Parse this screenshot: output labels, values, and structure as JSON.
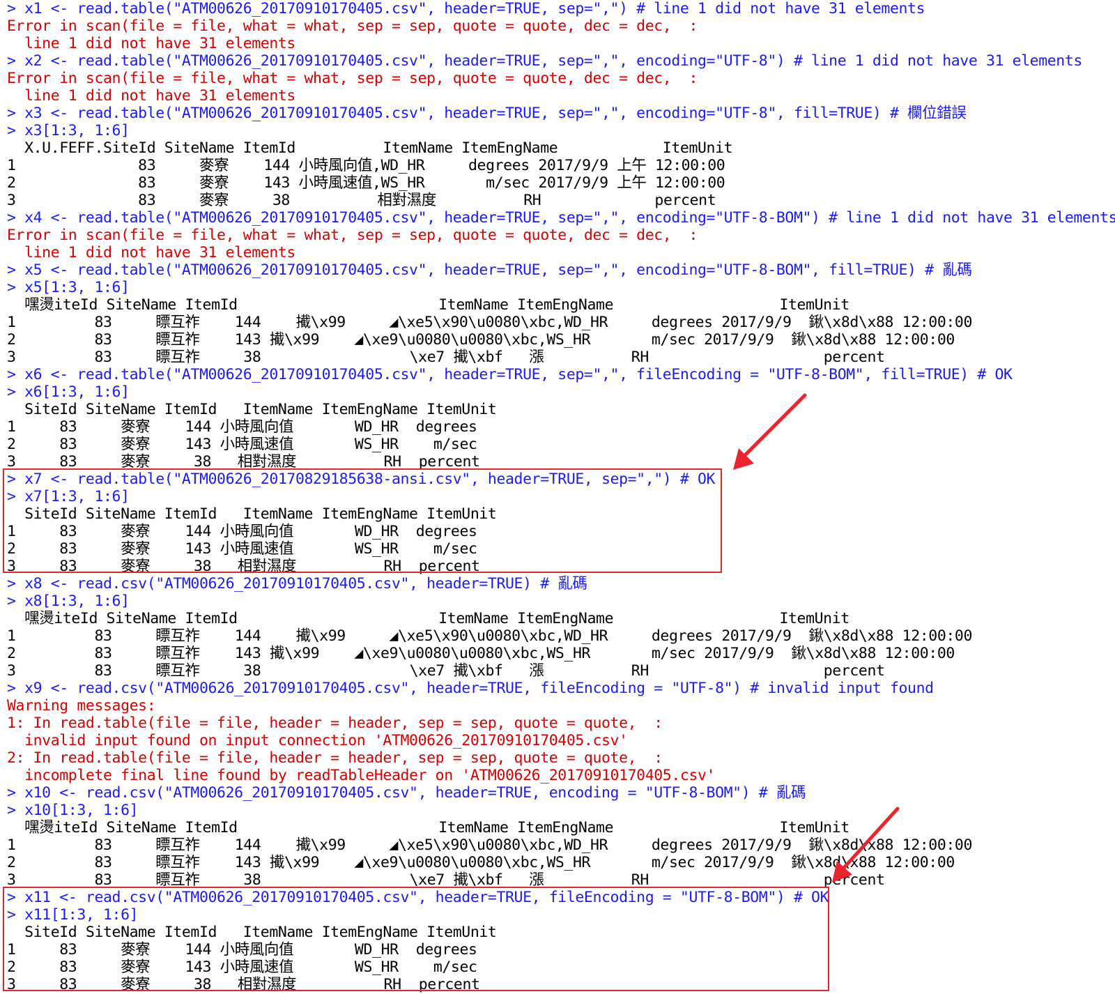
{
  "console": {
    "lines": [
      {
        "kind": "cmd",
        "text": "> x1 <- read.table(\"ATM00626_20170910170405.csv\", header=TRUE, sep=\",\") # line 1 did not have 31 elements"
      },
      {
        "kind": "err",
        "text": "Error in scan(file = file, what = what, sep = sep, quote = quote, dec = dec,  :"
      },
      {
        "kind": "err",
        "text": "  line 1 did not have 31 elements"
      },
      {
        "kind": "cmd",
        "text": "> x2 <- read.table(\"ATM00626_20170910170405.csv\", header=TRUE, sep=\",\", encoding=\"UTF-8\") # line 1 did not have 31 elements"
      },
      {
        "kind": "err",
        "text": "Error in scan(file = file, what = what, sep = sep, quote = quote, dec = dec,  :"
      },
      {
        "kind": "err",
        "text": "  line 1 did not have 31 elements"
      },
      {
        "kind": "cmd",
        "text": "> x3 <- read.table(\"ATM00626_20170910170405.csv\", header=TRUE, sep=\",\", encoding=\"UTF-8\", fill=TRUE) # 欄位錯誤"
      },
      {
        "kind": "cmd",
        "text": "> x3[1:3, 1:6]"
      },
      {
        "kind": "out",
        "text": "  X.U.FEFF.SiteId SiteName ItemId          ItemName ItemEngName            ItemUnit"
      },
      {
        "kind": "out",
        "text": "1              83     麥寮    144 小時風向值,WD_HR     degrees 2017/9/9 上午 12:00:00"
      },
      {
        "kind": "out",
        "text": "2              83     麥寮    143 小時風速值,WS_HR       m/sec 2017/9/9 上午 12:00:00"
      },
      {
        "kind": "out",
        "text": "3              83     麥寮     38          相對濕度          RH             percent"
      },
      {
        "kind": "cmd",
        "text": "> x4 <- read.table(\"ATM00626_20170910170405.csv\", header=TRUE, sep=\",\", encoding=\"UTF-8-BOM\") # line 1 did not have 31 elements"
      },
      {
        "kind": "err",
        "text": "Error in scan(file = file, what = what, sep = sep, quote = quote, dec = dec,  :"
      },
      {
        "kind": "err",
        "text": "  line 1 did not have 31 elements"
      },
      {
        "kind": "cmd",
        "text": "> x5 <- read.table(\"ATM00626_20170910170405.csv\", header=TRUE, sep=\",\", encoding=\"UTF-8-BOM\", fill=TRUE) # 亂碼"
      },
      {
        "kind": "cmd",
        "text": "> x5[1:3, 1:6]"
      },
      {
        "kind": "out",
        "text": "  嘿燙iteId SiteName ItemId                       ItemName ItemEngName                   ItemUnit"
      },
      {
        "kind": "out",
        "text": "1         83     瞟互祚    144    擮\\x99     ◢\\xe5\\x90\\u0080\\xbc,WD_HR     degrees 2017/9/9  鍬\\x8d\\x88 12:00:00"
      },
      {
        "kind": "out",
        "text": "2         83     瞟互祚    143 擮\\x99    ◢\\xe9\\u0080\\u0080\\xbc,WS_HR       m/sec 2017/9/9  鍬\\x8d\\x88 12:00:00"
      },
      {
        "kind": "out",
        "text": "3         83     瞟互祚     38                 \\xe7 擮\\xbf   漲          RH                    percent"
      },
      {
        "kind": "cmd",
        "text": "> x6 <- read.table(\"ATM00626_20170910170405.csv\", header=TRUE, sep=\",\", fileEncoding = \"UTF-8-BOM\", fill=TRUE) # OK"
      },
      {
        "kind": "cmd",
        "text": "> x6[1:3, 1:6]"
      },
      {
        "kind": "out",
        "text": "  SiteId SiteName ItemId   ItemName ItemEngName ItemUnit"
      },
      {
        "kind": "out",
        "text": "1     83     麥寮    144 小時風向值       WD_HR  degrees"
      },
      {
        "kind": "out",
        "text": "2     83     麥寮    143 小時風速值       WS_HR    m/sec"
      },
      {
        "kind": "out",
        "text": "3     83     麥寮     38   相對濕度          RH  percent"
      },
      {
        "kind": "cmd",
        "text": "> x7 <- read.table(\"ATM00626_20170829185638-ansi.csv\", header=TRUE, sep=\",\") # OK"
      },
      {
        "kind": "cmd",
        "text": "> x7[1:3, 1:6]"
      },
      {
        "kind": "out",
        "text": "  SiteId SiteName ItemId   ItemName ItemEngName ItemUnit"
      },
      {
        "kind": "out",
        "text": "1     83     麥寮    144 小時風向值       WD_HR  degrees"
      },
      {
        "kind": "out",
        "text": "2     83     麥寮    143 小時風速值       WS_HR    m/sec"
      },
      {
        "kind": "out",
        "text": "3     83     麥寮     38   相對濕度          RH  percent"
      },
      {
        "kind": "cmd",
        "text": "> x8 <- read.csv(\"ATM00626_20170910170405.csv\", header=TRUE) # 亂碼"
      },
      {
        "kind": "cmd",
        "text": "> x8[1:3, 1:6]"
      },
      {
        "kind": "out",
        "text": "  嘿燙iteId SiteName ItemId                       ItemName ItemEngName                   ItemUnit"
      },
      {
        "kind": "out",
        "text": "1         83     瞟互祚    144    擮\\x99     ◢\\xe5\\x90\\u0080\\xbc,WD_HR     degrees 2017/9/9  鍬\\x8d\\x88 12:00:00"
      },
      {
        "kind": "out",
        "text": "2         83     瞟互祚    143 擮\\x99    ◢\\xe9\\u0080\\u0080\\xbc,WS_HR       m/sec 2017/9/9  鍬\\x8d\\x88 12:00:00"
      },
      {
        "kind": "out",
        "text": "3         83     瞟互祚     38                 \\xe7 擮\\xbf   漲          RH                    percent"
      },
      {
        "kind": "cmd",
        "text": "> x9 <- read.csv(\"ATM00626_20170910170405.csv\", header=TRUE, fileEncoding = \"UTF-8\") # invalid input found"
      },
      {
        "kind": "err",
        "text": "Warning messages:"
      },
      {
        "kind": "err",
        "text": "1: In read.table(file = file, header = header, sep = sep, quote = quote,  :"
      },
      {
        "kind": "err",
        "text": "  invalid input found on input connection 'ATM00626_20170910170405.csv'"
      },
      {
        "kind": "err",
        "text": "2: In read.table(file = file, header = header, sep = sep, quote = quote,  :"
      },
      {
        "kind": "err",
        "text": "  incomplete final line found by readTableHeader on 'ATM00626_20170910170405.csv'"
      },
      {
        "kind": "cmd",
        "text": "> x10 <- read.csv(\"ATM00626_20170910170405.csv\", header=TRUE, encoding = \"UTF-8-BOM\") # 亂碼"
      },
      {
        "kind": "cmd",
        "text": "> x10[1:3, 1:6]"
      },
      {
        "kind": "out",
        "text": "  嘿燙iteId SiteName ItemId                       ItemName ItemEngName                   ItemUnit"
      },
      {
        "kind": "out",
        "text": "1         83     瞟互祚    144    擮\\x99     ◢\\xe5\\x90\\u0080\\xbc,WD_HR     degrees 2017/9/9  鍬\\x8d\\x88 12:00:00"
      },
      {
        "kind": "out",
        "text": "2         83     瞟互祚    143 擮\\x99    ◢\\xe9\\u0080\\u0080\\xbc,WS_HR       m/sec 2017/9/9  鍬\\x8d\\x88 12:00:00"
      },
      {
        "kind": "out",
        "text": "3         83     瞟互祚     38                 \\xe7 擮\\xbf   漲          RH                    percent"
      },
      {
        "kind": "cmd",
        "text": "> x11 <- read.csv(\"ATM00626_20170910170405.csv\", header=TRUE, fileEncoding = \"UTF-8-BOM\") # OK"
      },
      {
        "kind": "cmd",
        "text": "> x11[1:3, 1:6]"
      },
      {
        "kind": "out",
        "text": "  SiteId SiteName ItemId   ItemName ItemEngName ItemUnit"
      },
      {
        "kind": "out",
        "text": "1     83     麥寮    144 小時風向值       WD_HR  degrees"
      },
      {
        "kind": "out",
        "text": "2     83     麥寮    143 小時風速值       WS_HR    m/sec"
      },
      {
        "kind": "out",
        "text": "3     83     麥寮     38   相對濕度          RH  percent"
      }
    ]
  },
  "colors": {
    "command": "#1a1aff",
    "error": "#d80000",
    "output": "#000000",
    "highlight": "#e8242c"
  },
  "annotations": [
    {
      "kind": "highlight-box",
      "target": "x7 block"
    },
    {
      "kind": "highlight-box",
      "target": "x11 block"
    },
    {
      "kind": "arrow-icon",
      "target": "x7 block"
    },
    {
      "kind": "arrow-icon",
      "target": "x11 block"
    }
  ]
}
